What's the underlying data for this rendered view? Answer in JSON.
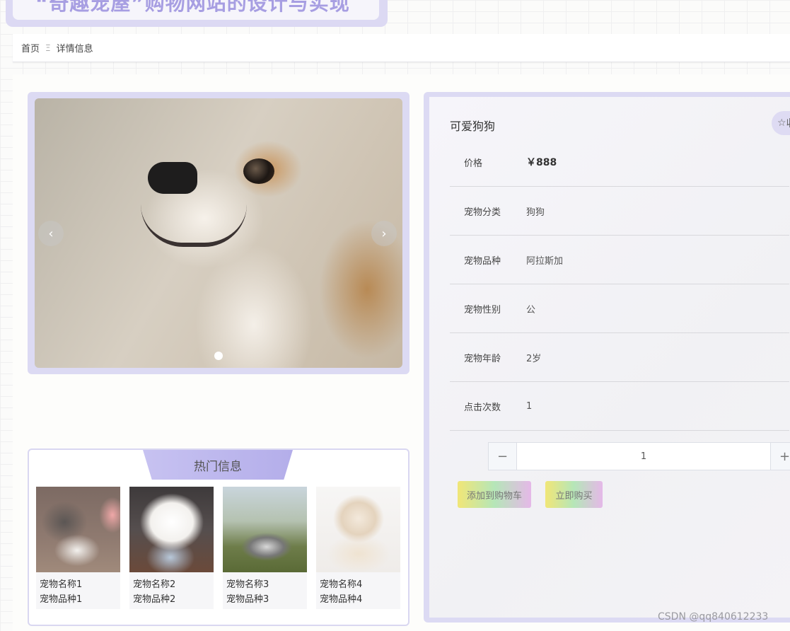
{
  "page_title": "“奇趣宠屋”购物网站的设计与实现",
  "breadcrumb": {
    "home": "首页",
    "separator": "Ξ",
    "current": "详情信息"
  },
  "carousel": {
    "prev_icon": "‹",
    "next_icon": "›"
  },
  "hot": {
    "title": "热门信息",
    "items": [
      {
        "name": "宠物名称1",
        "breed": "宠物品种1"
      },
      {
        "name": "宠物名称2",
        "breed": "宠物品种2"
      },
      {
        "name": "宠物名称3",
        "breed": "宠物品种3"
      },
      {
        "name": "宠物名称4",
        "breed": "宠物品种4"
      }
    ]
  },
  "detail": {
    "title": "可爱狗狗",
    "favorite_icon": "☆",
    "favorite_label": "收",
    "rows": [
      {
        "label": "价格",
        "value": "￥888"
      },
      {
        "label": "宠物分类",
        "value": "狗狗"
      },
      {
        "label": "宠物品种",
        "value": "阿拉斯加"
      },
      {
        "label": "宠物性别",
        "value": "公"
      },
      {
        "label": "宠物年龄",
        "value": "2岁"
      },
      {
        "label": "点击次数",
        "value": "1"
      }
    ],
    "quantity": "1",
    "minus_label": "−",
    "plus_label": "+",
    "add_to_cart": "添加到购物车",
    "buy_now": "立即购买"
  },
  "watermark": "CSDN @qq840612233",
  "colors": {
    "accent": "#dcdaf3",
    "title": "#a79ee2",
    "hot_tab": "#c7c2f1"
  }
}
